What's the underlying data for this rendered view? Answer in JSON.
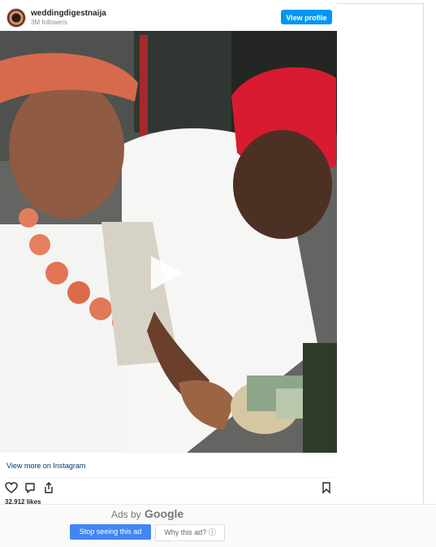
{
  "post": {
    "username": "weddingdigestnaija",
    "followers": "3M followers",
    "view_profile": "View profile",
    "view_more": "View more on Instagram",
    "likes": "32,912 likes"
  },
  "ad": {
    "ads_by": "Ads by",
    "google": "Google",
    "stop": "Stop seeing this ad",
    "why": "Why this ad? ⓘ"
  },
  "colors": {
    "button_blue": "#0095f6",
    "link_blue": "#00376b",
    "stop_ad_blue": "#4285f4"
  },
  "icons": {
    "like": "heart-icon",
    "comment": "comment-icon",
    "share": "share-icon",
    "save": "bookmark-icon",
    "play": "play-icon"
  }
}
